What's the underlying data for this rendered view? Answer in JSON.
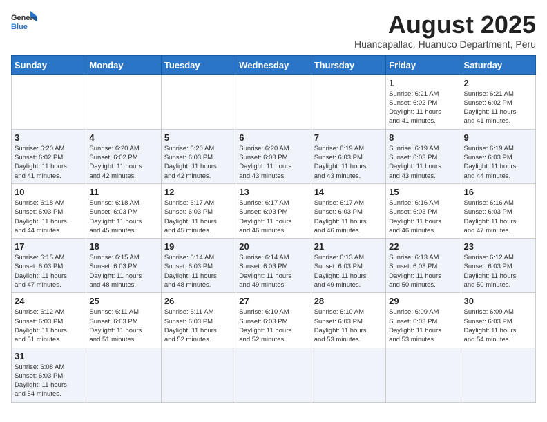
{
  "logo": {
    "line1": "General",
    "line2": "Blue"
  },
  "title": "August 2025",
  "subtitle": "Huancapallac, Huanuco Department, Peru",
  "days_of_week": [
    "Sunday",
    "Monday",
    "Tuesday",
    "Wednesday",
    "Thursday",
    "Friday",
    "Saturday"
  ],
  "weeks": [
    [
      {
        "day": "",
        "info": ""
      },
      {
        "day": "",
        "info": ""
      },
      {
        "day": "",
        "info": ""
      },
      {
        "day": "",
        "info": ""
      },
      {
        "day": "",
        "info": ""
      },
      {
        "day": "1",
        "info": "Sunrise: 6:21 AM\nSunset: 6:02 PM\nDaylight: 11 hours\nand 41 minutes."
      },
      {
        "day": "2",
        "info": "Sunrise: 6:21 AM\nSunset: 6:02 PM\nDaylight: 11 hours\nand 41 minutes."
      }
    ],
    [
      {
        "day": "3",
        "info": "Sunrise: 6:20 AM\nSunset: 6:02 PM\nDaylight: 11 hours\nand 41 minutes."
      },
      {
        "day": "4",
        "info": "Sunrise: 6:20 AM\nSunset: 6:02 PM\nDaylight: 11 hours\nand 42 minutes."
      },
      {
        "day": "5",
        "info": "Sunrise: 6:20 AM\nSunset: 6:03 PM\nDaylight: 11 hours\nand 42 minutes."
      },
      {
        "day": "6",
        "info": "Sunrise: 6:20 AM\nSunset: 6:03 PM\nDaylight: 11 hours\nand 43 minutes."
      },
      {
        "day": "7",
        "info": "Sunrise: 6:19 AM\nSunset: 6:03 PM\nDaylight: 11 hours\nand 43 minutes."
      },
      {
        "day": "8",
        "info": "Sunrise: 6:19 AM\nSunset: 6:03 PM\nDaylight: 11 hours\nand 43 minutes."
      },
      {
        "day": "9",
        "info": "Sunrise: 6:19 AM\nSunset: 6:03 PM\nDaylight: 11 hours\nand 44 minutes."
      }
    ],
    [
      {
        "day": "10",
        "info": "Sunrise: 6:18 AM\nSunset: 6:03 PM\nDaylight: 11 hours\nand 44 minutes."
      },
      {
        "day": "11",
        "info": "Sunrise: 6:18 AM\nSunset: 6:03 PM\nDaylight: 11 hours\nand 45 minutes."
      },
      {
        "day": "12",
        "info": "Sunrise: 6:17 AM\nSunset: 6:03 PM\nDaylight: 11 hours\nand 45 minutes."
      },
      {
        "day": "13",
        "info": "Sunrise: 6:17 AM\nSunset: 6:03 PM\nDaylight: 11 hours\nand 46 minutes."
      },
      {
        "day": "14",
        "info": "Sunrise: 6:17 AM\nSunset: 6:03 PM\nDaylight: 11 hours\nand 46 minutes."
      },
      {
        "day": "15",
        "info": "Sunrise: 6:16 AM\nSunset: 6:03 PM\nDaylight: 11 hours\nand 46 minutes."
      },
      {
        "day": "16",
        "info": "Sunrise: 6:16 AM\nSunset: 6:03 PM\nDaylight: 11 hours\nand 47 minutes."
      }
    ],
    [
      {
        "day": "17",
        "info": "Sunrise: 6:15 AM\nSunset: 6:03 PM\nDaylight: 11 hours\nand 47 minutes."
      },
      {
        "day": "18",
        "info": "Sunrise: 6:15 AM\nSunset: 6:03 PM\nDaylight: 11 hours\nand 48 minutes."
      },
      {
        "day": "19",
        "info": "Sunrise: 6:14 AM\nSunset: 6:03 PM\nDaylight: 11 hours\nand 48 minutes."
      },
      {
        "day": "20",
        "info": "Sunrise: 6:14 AM\nSunset: 6:03 PM\nDaylight: 11 hours\nand 49 minutes."
      },
      {
        "day": "21",
        "info": "Sunrise: 6:13 AM\nSunset: 6:03 PM\nDaylight: 11 hours\nand 49 minutes."
      },
      {
        "day": "22",
        "info": "Sunrise: 6:13 AM\nSunset: 6:03 PM\nDaylight: 11 hours\nand 50 minutes."
      },
      {
        "day": "23",
        "info": "Sunrise: 6:12 AM\nSunset: 6:03 PM\nDaylight: 11 hours\nand 50 minutes."
      }
    ],
    [
      {
        "day": "24",
        "info": "Sunrise: 6:12 AM\nSunset: 6:03 PM\nDaylight: 11 hours\nand 51 minutes."
      },
      {
        "day": "25",
        "info": "Sunrise: 6:11 AM\nSunset: 6:03 PM\nDaylight: 11 hours\nand 51 minutes."
      },
      {
        "day": "26",
        "info": "Sunrise: 6:11 AM\nSunset: 6:03 PM\nDaylight: 11 hours\nand 52 minutes."
      },
      {
        "day": "27",
        "info": "Sunrise: 6:10 AM\nSunset: 6:03 PM\nDaylight: 11 hours\nand 52 minutes."
      },
      {
        "day": "28",
        "info": "Sunrise: 6:10 AM\nSunset: 6:03 PM\nDaylight: 11 hours\nand 53 minutes."
      },
      {
        "day": "29",
        "info": "Sunrise: 6:09 AM\nSunset: 6:03 PM\nDaylight: 11 hours\nand 53 minutes."
      },
      {
        "day": "30",
        "info": "Sunrise: 6:09 AM\nSunset: 6:03 PM\nDaylight: 11 hours\nand 54 minutes."
      }
    ],
    [
      {
        "day": "31",
        "info": "Sunrise: 6:08 AM\nSunset: 6:03 PM\nDaylight: 11 hours\nand 54 minutes."
      },
      {
        "day": "",
        "info": ""
      },
      {
        "day": "",
        "info": ""
      },
      {
        "day": "",
        "info": ""
      },
      {
        "day": "",
        "info": ""
      },
      {
        "day": "",
        "info": ""
      },
      {
        "day": "",
        "info": ""
      }
    ]
  ]
}
